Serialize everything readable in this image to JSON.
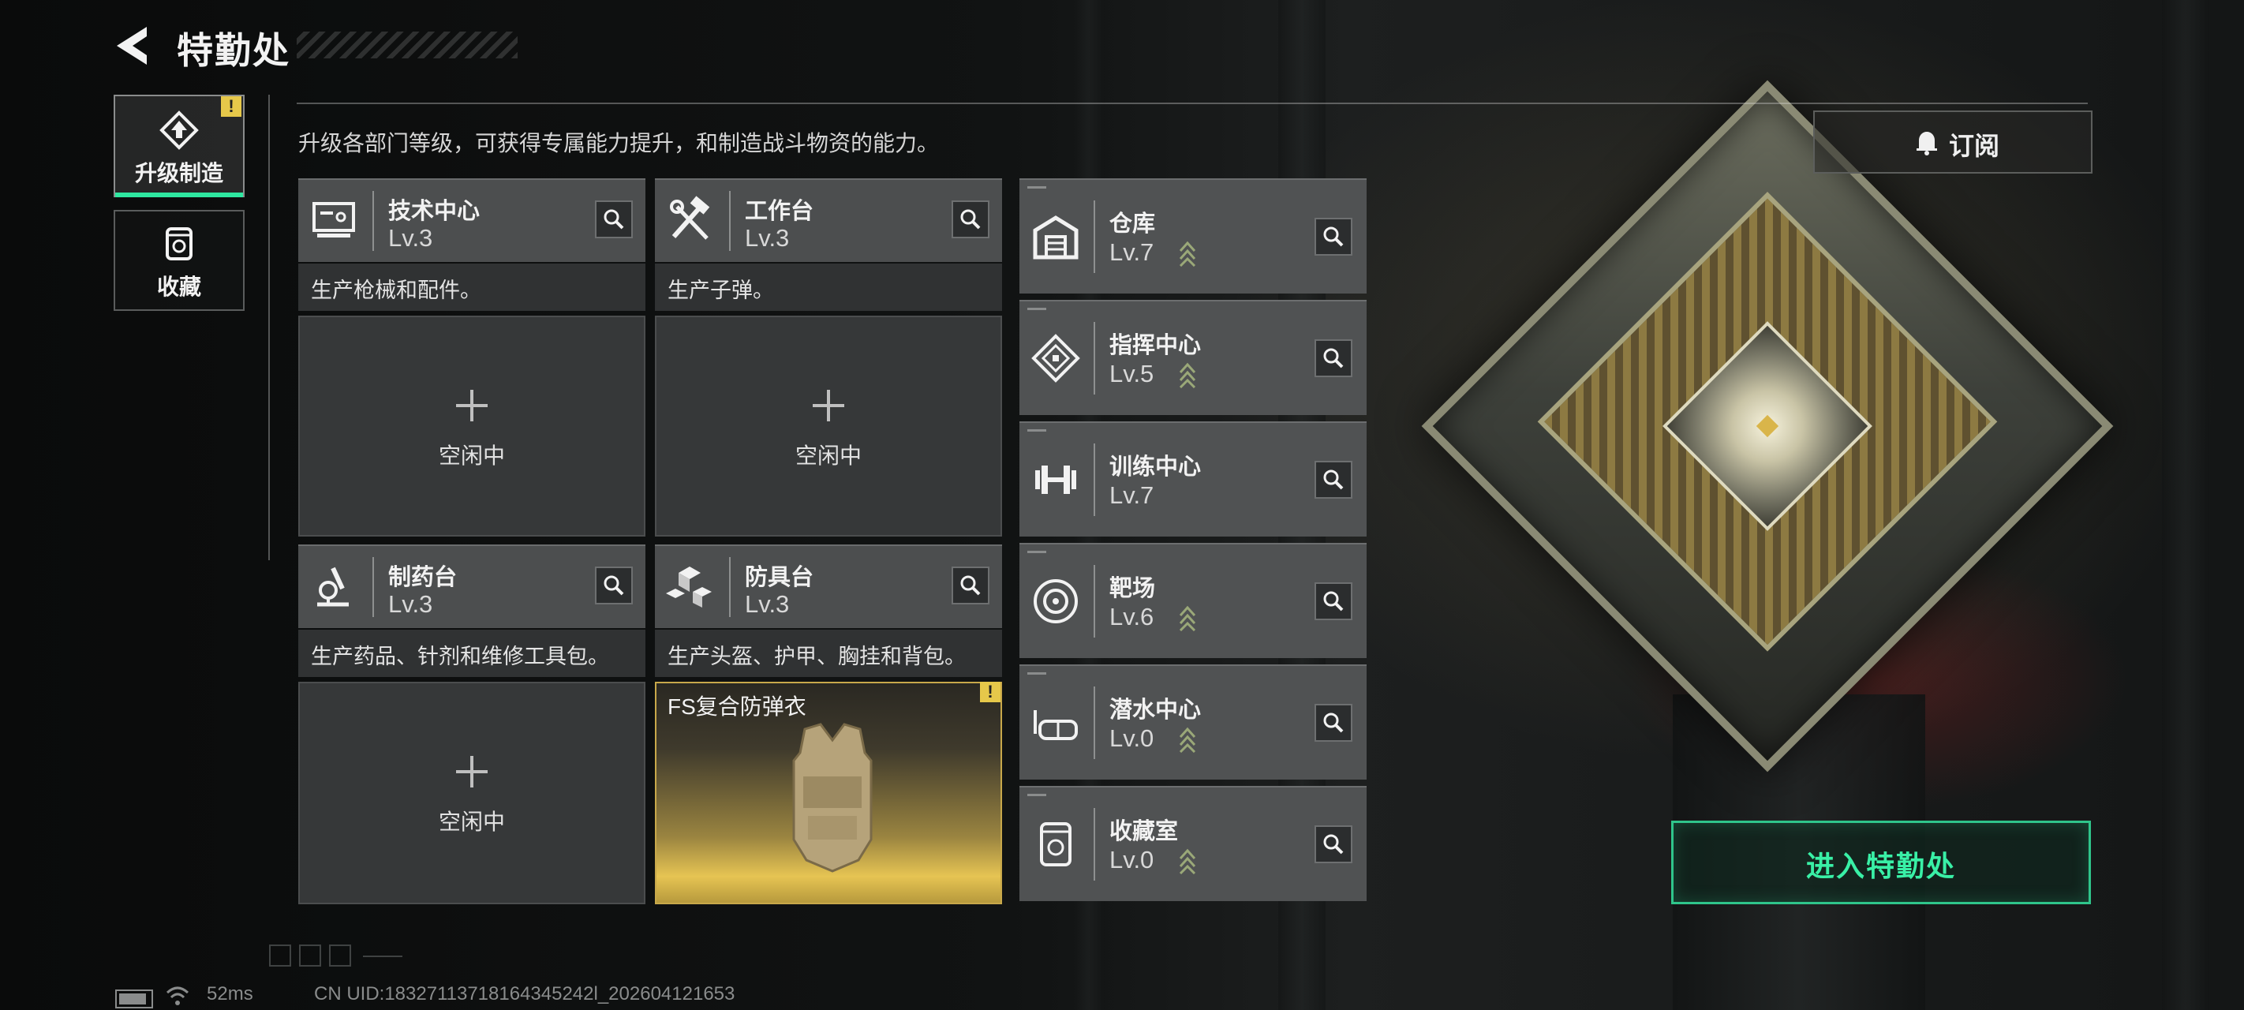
{
  "header": {
    "title": "特勤处"
  },
  "side_tabs": [
    {
      "label": "升级制造",
      "active": true,
      "alert": "!"
    },
    {
      "label": "收藏",
      "active": false
    }
  ],
  "description": "升级各部门等级，可获得专属能力提升，和制造战斗物资的能力。",
  "subscribe": {
    "label": "订阅"
  },
  "workshops": [
    {
      "name": "技术中心",
      "level": "Lv.3",
      "icon": "tech-center-icon",
      "desc": "生产枪械和配件。",
      "slot": {
        "state": "idle",
        "label": "空闲中"
      }
    },
    {
      "name": "工作台",
      "level": "Lv.3",
      "icon": "workbench-icon",
      "desc": "生产子弹。",
      "slot": {
        "state": "idle",
        "label": "空闲中"
      }
    },
    {
      "name": "制药台",
      "level": "Lv.3",
      "icon": "pharmacy-icon",
      "desc": "生产药品、针剂和维修工具包。",
      "slot": {
        "state": "idle",
        "label": "空闲中"
      }
    },
    {
      "name": "防具台",
      "level": "Lv.3",
      "icon": "armor-bench-icon",
      "desc": "生产头盔、护甲、胸挂和背包。",
      "slot": {
        "state": "item",
        "label": "FS复合防弹衣",
        "alert": "!"
      }
    }
  ],
  "facilities": [
    {
      "name": "仓库",
      "level": "Lv.7",
      "icon": "warehouse-icon",
      "upgradeable": true
    },
    {
      "name": "指挥中心",
      "level": "Lv.5",
      "icon": "command-center-icon",
      "upgradeable": true
    },
    {
      "name": "训练中心",
      "level": "Lv.7",
      "icon": "training-center-icon",
      "upgradeable": false
    },
    {
      "name": "靶场",
      "level": "Lv.6",
      "icon": "shooting-range-icon",
      "upgradeable": true
    },
    {
      "name": "潜水中心",
      "level": "Lv.0",
      "icon": "diving-center-icon",
      "upgradeable": true
    },
    {
      "name": "收藏室",
      "level": "Lv.0",
      "icon": "collection-room-icon",
      "upgradeable": true
    }
  ],
  "enter_button": {
    "label": "进入特勤处"
  },
  "status_bar": {
    "ping": "52ms",
    "uid": "CN UID:18327113718164345242l_202604121653"
  },
  "colors": {
    "accent": "#39f0a6",
    "alert": "#e6c84a",
    "gold": "#e6c453",
    "panel": "#4c4e4f"
  }
}
